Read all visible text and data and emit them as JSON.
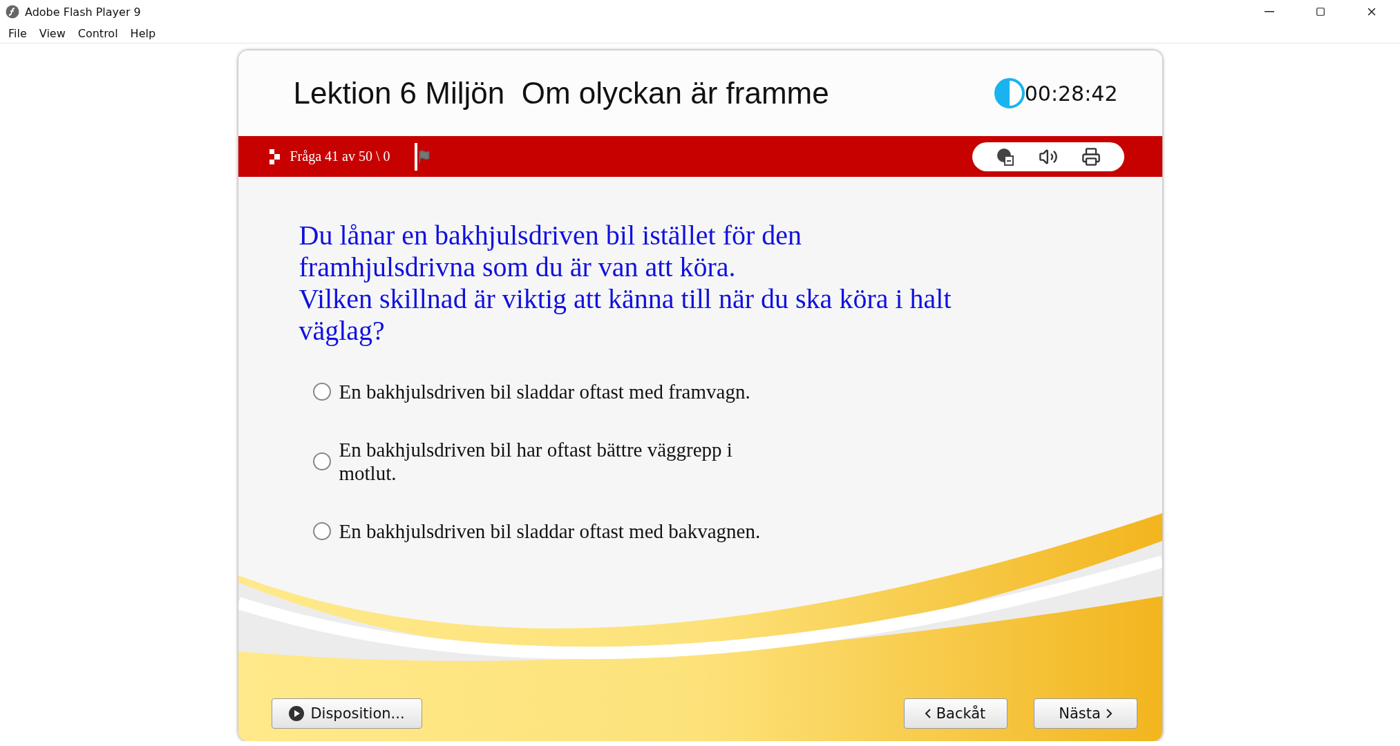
{
  "window": {
    "title": "Adobe Flash Player 9"
  },
  "menu": [
    "File",
    "View",
    "Control",
    "Help"
  ],
  "lesson": {
    "title": "Lektion 6 Miljön  Om olyckan är framme",
    "timer": "00:28:42"
  },
  "toolbar": {
    "progress": "Fråga 41 av 50 \\ 0"
  },
  "question": {
    "lines": [
      "Du lånar en bakhjulsdriven bil istället för den",
      "framhjulsdrivna som du är van att köra.",
      "Vilken skillnad är viktig att känna till när du ska köra i halt",
      "väglag?"
    ]
  },
  "options": [
    {
      "text": "En bakhjulsdriven bil sladdar oftast med framvagn.",
      "selected": false
    },
    {
      "text": "En bakhjulsdriven bil har oftast bättre väggrepp i motlut.",
      "selected": false
    },
    {
      "text": "En bakhjulsdriven bil sladdar oftast med bakvagnen.",
      "selected": false
    }
  ],
  "buttons": {
    "outline": "Disposition...",
    "back": "Backåt",
    "next": "Nästa"
  }
}
